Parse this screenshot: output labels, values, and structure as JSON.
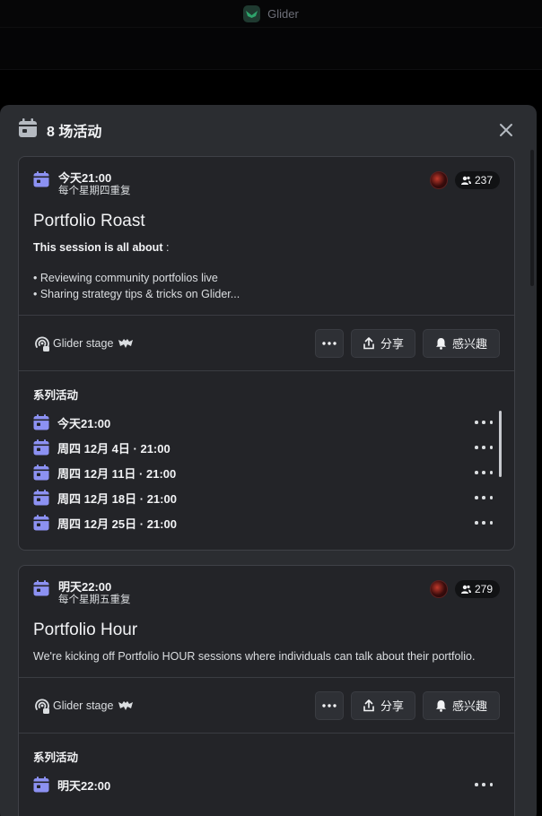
{
  "app": {
    "title": "Glider"
  },
  "modal": {
    "title": "8 场活动"
  },
  "events": [
    {
      "when": "今天21:00",
      "repeat": "每个星期四重复",
      "interested_count": "237",
      "name": "Portfolio Roast",
      "description_bold": "This session is all about",
      "description_colon": " :",
      "description_lines": [
        "• Reviewing community portfolios live",
        "• Sharing strategy tips & tricks on Glider..."
      ],
      "location": "Glider stage",
      "share_label": "分享",
      "interested_label": "感兴趣",
      "series_title": "系列活动",
      "series": [
        "今天21:00",
        "周四 12月 4日 · 21:00",
        "周四 12月 11日 · 21:00",
        "周四 12月 18日 · 21:00",
        "周四 12月 25日 · 21:00"
      ]
    },
    {
      "when": "明天22:00",
      "repeat": "每个星期五重复",
      "interested_count": "279",
      "name": "Portfolio Hour",
      "description": "We're kicking off Portfolio HOUR sessions where individuals can talk about their portfolio.",
      "location": "Glider stage",
      "share_label": "分享",
      "interested_label": "感兴趣",
      "series_title": "系列活动",
      "series": [
        "明天22:00"
      ]
    }
  ],
  "colors": {
    "accent_icon": "#8c91f2",
    "background": "#2b2d31",
    "card": "#232428"
  },
  "icons": [
    "calendar-icon",
    "close-icon",
    "people-icon",
    "stage-icon",
    "bat-icon",
    "share-icon",
    "bell-icon",
    "more-icon"
  ]
}
